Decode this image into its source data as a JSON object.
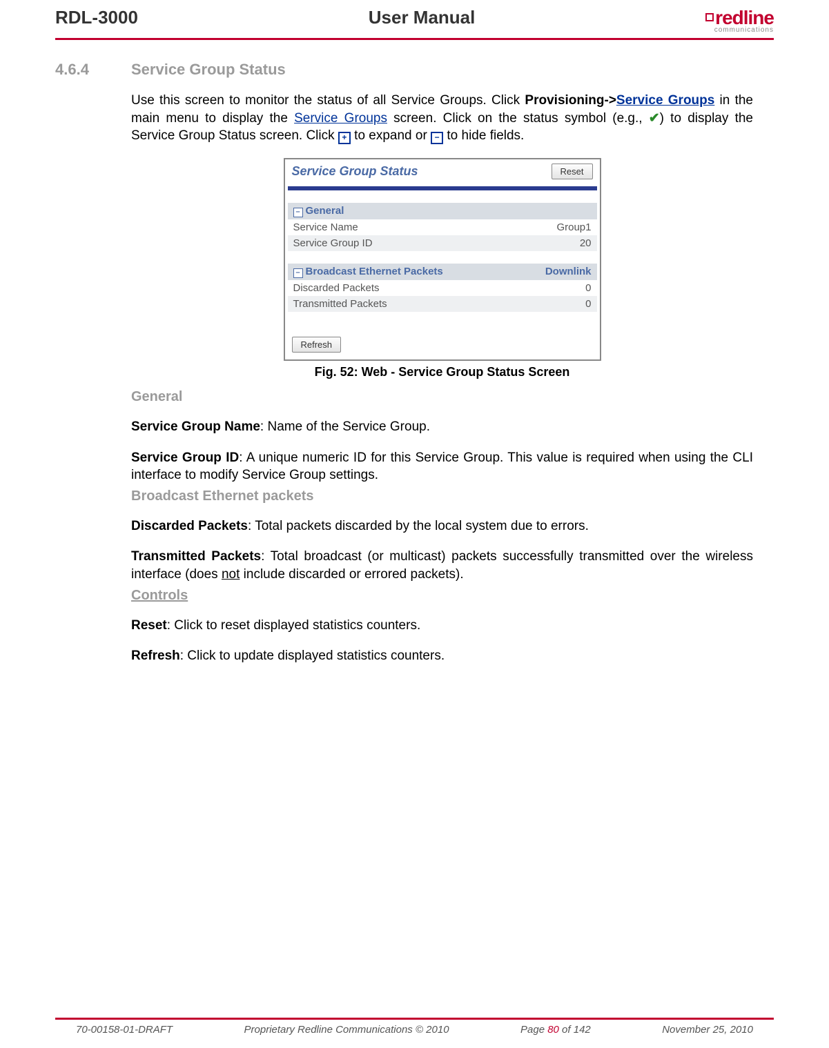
{
  "header": {
    "left": "RDL-3000",
    "center": "User Manual",
    "logo_word": "redline",
    "logo_sub": "communications"
  },
  "section": {
    "num": "4.6.4",
    "title": "Service Group Status"
  },
  "intro": {
    "l1a": "Use this screen to monitor the status of all Service Groups. Click ",
    "l1b": "Provisioning->",
    "l1c": "Service Groups",
    "l1d": " in the main menu to display the ",
    "l1e": "Service Groups",
    "l1f": " screen. Click on the status symbol (e.g., ",
    "l1g": ") to display the Service Group Status screen. Click ",
    "l1h": " to expand or ",
    "l1i": " to hide fields."
  },
  "screenshot": {
    "title": "Service Group Status",
    "reset_btn": "Reset",
    "refresh_btn": "Refresh",
    "sec1": {
      "header": "General",
      "rows": [
        {
          "label": "Service Name",
          "value": "Group1"
        },
        {
          "label": "Service Group ID",
          "value": "20"
        }
      ]
    },
    "sec2": {
      "header": "Broadcast Ethernet Packets",
      "header_right": "Downlink",
      "rows": [
        {
          "label": "Discarded Packets",
          "value": "0"
        },
        {
          "label": "Transmitted Packets",
          "value": "0"
        }
      ]
    }
  },
  "fig_caption": "Fig. 52: Web - Service Group Status Screen",
  "headings": {
    "general": "General",
    "bcast": "Broadcast Ethernet packets",
    "controls": "Controls"
  },
  "defs": {
    "sgn_term": "Service Group Name",
    "sgn_text": ": Name of the Service Group.",
    "sgid_term": "Service Group ID",
    "sgid_text": ": A unique numeric ID for this Service Group. This value is required when using the CLI interface to modify Service Group settings.",
    "dp_term": "Discarded Packets",
    "dp_text": ": Total packets discarded by the local system due to errors.",
    "tp_term": "Transmitted Packets",
    "tp_text_a": ": Total broadcast (or multicast) packets successfully transmitted over the wireless interface (does ",
    "tp_not": "not",
    "tp_text_b": " include discarded or errored packets).",
    "reset_term": "Reset",
    "reset_text": ": Click to reset displayed statistics counters.",
    "refresh_term": "Refresh",
    "refresh_text": ": Click to update displayed statistics counters."
  },
  "footer": {
    "doc_id": "70-00158-01-DRAFT",
    "copyright": "Proprietary Redline Communications © 2010",
    "page_a": "Page ",
    "page_n": "80",
    "page_b": " of 142",
    "date": "November 25, 2010"
  }
}
